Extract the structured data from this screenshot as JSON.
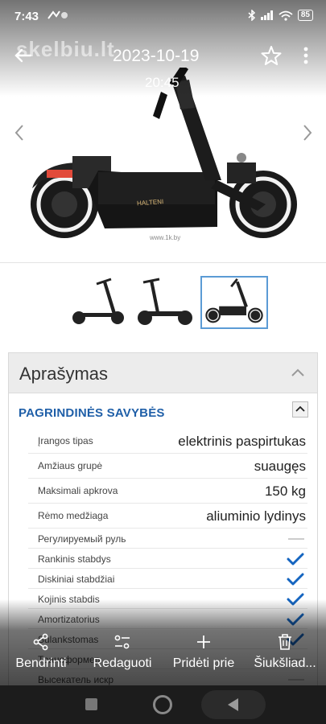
{
  "status_bar": {
    "time": "7:43",
    "battery": "85"
  },
  "top_bar": {
    "watermark": "skelbiu.lt",
    "date": "2023-10-19",
    "time": "20:45"
  },
  "photo": {
    "credit": "www.1k.by"
  },
  "thumbnails": {
    "count": 3,
    "selected_index": 2
  },
  "description": {
    "title": "Aprašymas",
    "section_title": "PAGRINDINĖS SAVYBĖS",
    "rows": [
      {
        "label": "Įrangos tipas",
        "value": "elektrinis paspirtukas"
      },
      {
        "label": "Amžiaus grupė",
        "value": "suaugęs"
      },
      {
        "label": "Maksimali apkrova",
        "value": "150 kg"
      },
      {
        "label": "Rėmo medžiaga",
        "value": "aliuminio lydinys"
      }
    ],
    "feature_rows": [
      {
        "label": "Регулируемый руль",
        "checked": false
      },
      {
        "label": "Rankinis stabdys",
        "checked": true
      },
      {
        "label": "Diskiniai stabdžiai",
        "checked": true
      },
      {
        "label": "Kojinis stabdis",
        "checked": true
      },
      {
        "label": "Amortizatorius",
        "checked": true
      },
      {
        "label": "Sulankstomas",
        "checked": true
      },
      {
        "label": "Трансформер",
        "checked": false
      },
      {
        "label": "Высекатель искр",
        "checked": false
      }
    ]
  },
  "actions": {
    "share": "Bendrinti",
    "edit": "Redaguoti",
    "add": "Pridėti prie",
    "delete": "Šiukšliad..."
  },
  "colors": {
    "accent": "#1f5fa8",
    "check": "#1565c0"
  }
}
